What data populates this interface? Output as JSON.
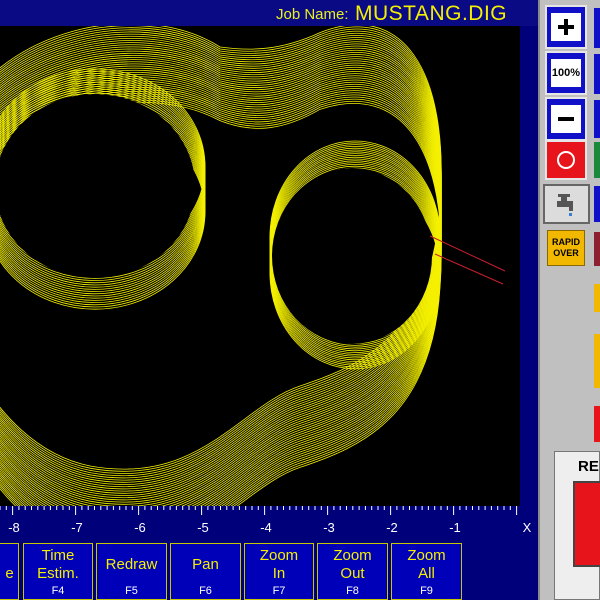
{
  "header": {
    "job_label": "Job Name:",
    "job_value": "MUSTANG.DIG"
  },
  "axis": {
    "ticks": [
      "-8",
      "-7",
      "-6",
      "-5",
      "-4",
      "-3",
      "-2",
      "-1"
    ],
    "end_label": "X"
  },
  "function_keys": [
    {
      "line1": "e",
      "line2": "",
      "sub": ""
    },
    {
      "line1": "Time",
      "line2": "Estim.",
      "sub": "F4"
    },
    {
      "line1": "Redraw",
      "line2": "",
      "sub": "F5"
    },
    {
      "line1": "Pan",
      "line2": "",
      "sub": "F6"
    },
    {
      "line1": "Zoom",
      "line2": "In",
      "sub": "F7"
    },
    {
      "line1": "Zoom",
      "line2": "Out",
      "sub": "F8"
    },
    {
      "line1": "Zoom",
      "line2": "All",
      "sub": "F9"
    }
  ],
  "side_panel": {
    "zoom_in_icon": "plus-icon",
    "zoom_100_label": "100%",
    "zoom_out_icon": "minus-icon",
    "stop_icon": "stop-circle-icon",
    "coolant_icon": "faucet-icon",
    "rapid_label_1": "RAPID",
    "rapid_label_2": "OVER",
    "reset_label": "RE"
  },
  "colors": {
    "screen_bg": "#00007b",
    "toolpath": "#f4f000",
    "text_yellow": "#e9f020",
    "panel_gray": "#c0c0c0",
    "alert_red": "#e8141c",
    "rapid_bg": "#f2b800"
  }
}
